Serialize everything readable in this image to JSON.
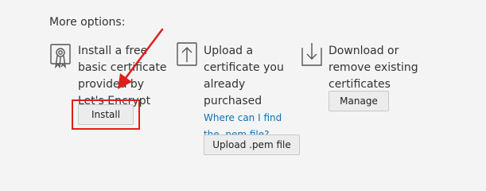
{
  "section": {
    "title": "More options:"
  },
  "options": [
    {
      "icon": "certificate-badge-icon",
      "lines": [
        "Install a free",
        "basic certificate",
        "provided by",
        "Let's Encrypt"
      ],
      "button_label": "Install"
    },
    {
      "icon": "upload-arrow-icon",
      "lines": [
        "Upload a",
        "certificate you",
        "already",
        "purchased"
      ],
      "link_lines": [
        "Where can I find",
        "the .pem file?"
      ],
      "button_label": "Upload .pem file"
    },
    {
      "icon": "download-arrow-icon",
      "lines": [
        "Download or",
        "remove existing",
        "certificates"
      ],
      "button_label": "Manage"
    }
  ],
  "annotation": {
    "highlight_color": "#e11d1d"
  },
  "colors": {
    "background": "#f4f4f4",
    "link": "#0a74b8",
    "button_bg": "#ececec"
  }
}
